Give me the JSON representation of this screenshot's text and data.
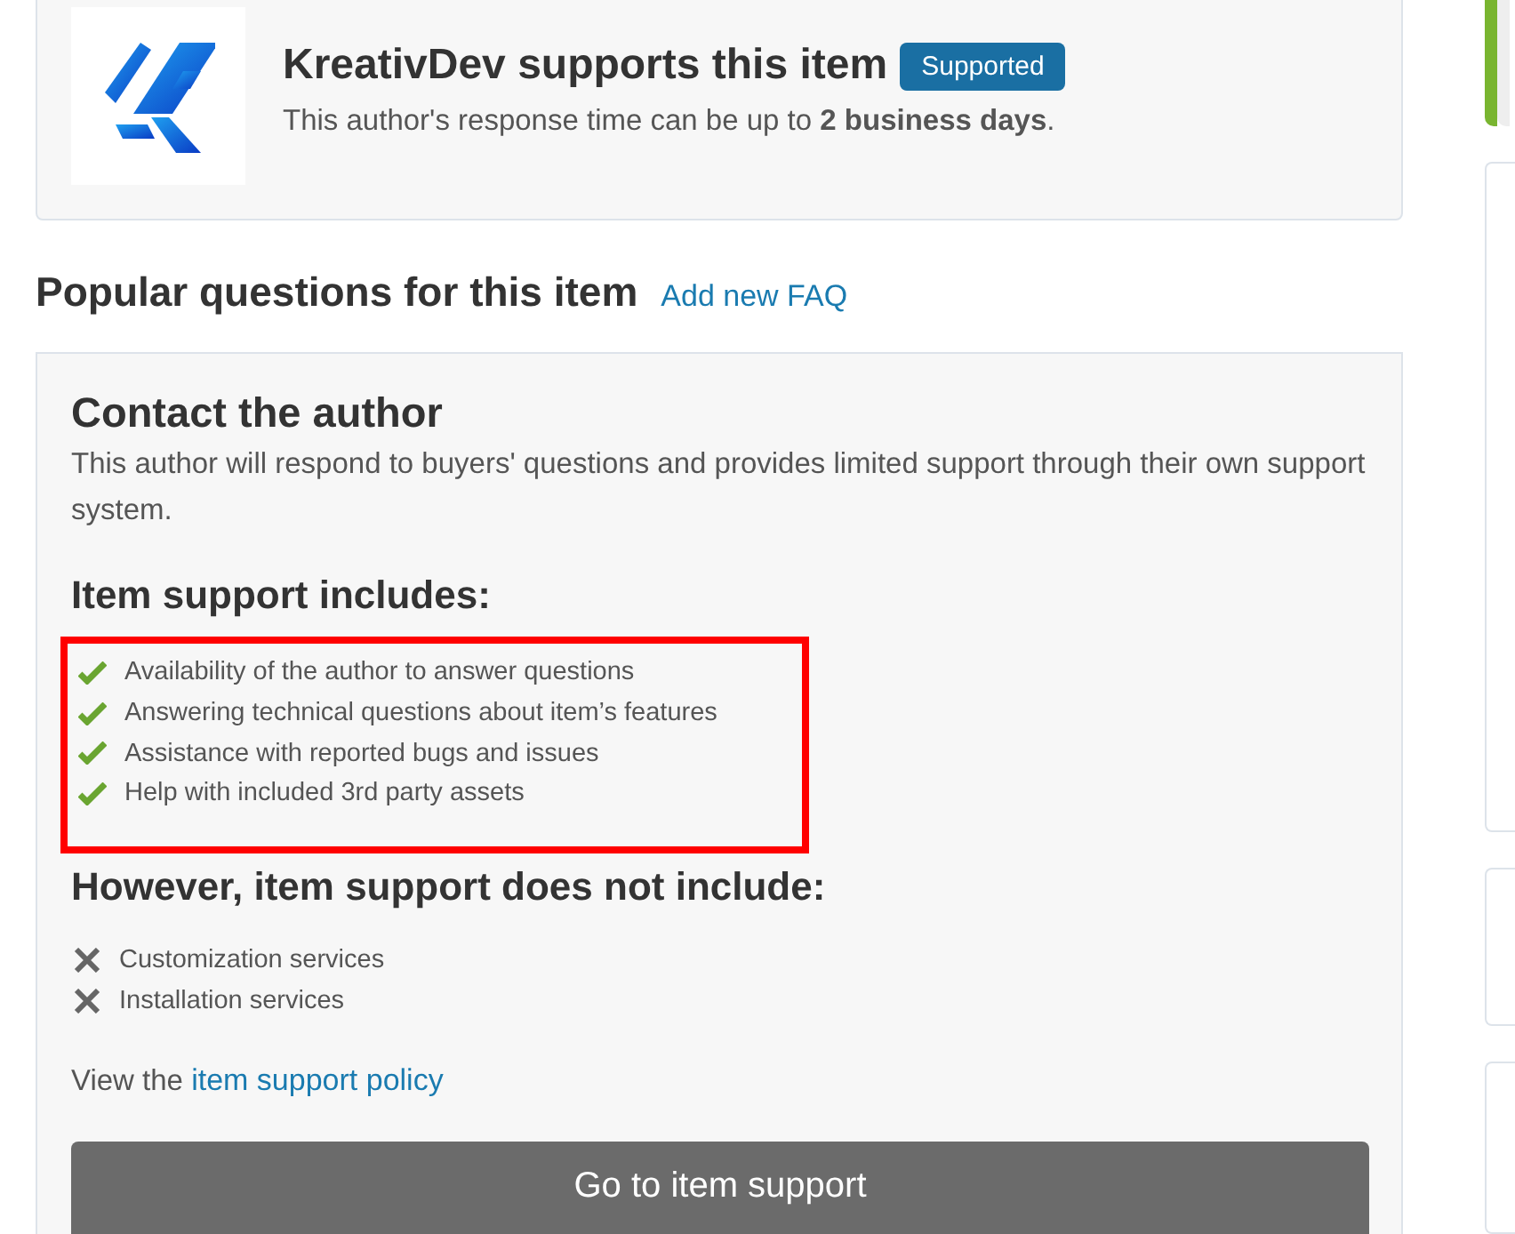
{
  "author_card": {
    "title": "KreativDev supports this item",
    "badge": "Supported",
    "response_text": "This author's response time can be up to **2 business days**."
  },
  "faq_header": {
    "title": "Popular questions for this item",
    "link": "Add new FAQ"
  },
  "contact": {
    "title": "Contact the author",
    "description": "This author will respond to buyers' questions and provides limited support through their own support system.",
    "includes_title": "Item support includes:",
    "includes_highlighted": true,
    "includes": [
      {
        "text": "Availability of the author to answer questions",
        "kind": "check"
      },
      {
        "text": "Answering technical questions about item’s features",
        "kind": "check"
      },
      {
        "text": "Assistance with reported bugs and issues",
        "kind": "check"
      },
      {
        "text": "Help with included 3rd party assets",
        "kind": "check"
      }
    ],
    "excludes_title": "However, item support does not include:",
    "excludes": [
      {
        "text": "Customization services",
        "kind": "cross"
      },
      {
        "text": "Installation services",
        "kind": "cross"
      }
    ],
    "policy_prefix": "View the",
    "policy_link": "item support policy",
    "button": "Go to item support"
  }
}
